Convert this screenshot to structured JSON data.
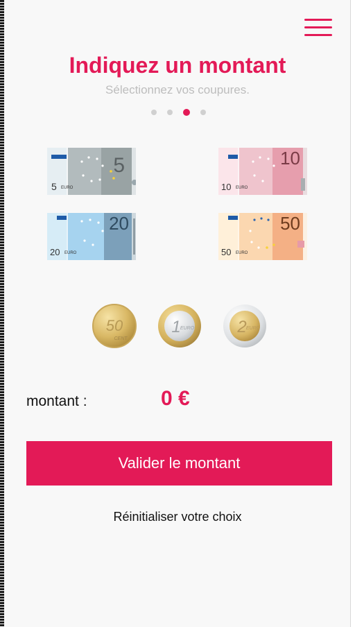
{
  "header": {
    "menu_icon": "hamburger-menu-icon",
    "title": "Indiquez un montant",
    "subtitle": "Sélectionnez vos coupures.",
    "steps_total": 4,
    "active_step": 3
  },
  "notes": [
    {
      "value": "5",
      "euro_label": "EURO",
      "color": "#a6aeb0"
    },
    {
      "value": "10",
      "euro_label": "EURO",
      "color": "#e79aa8"
    },
    {
      "value": "20",
      "euro_label": "EURO",
      "color": "#8ec3e6"
    },
    {
      "value": "50",
      "euro_label": "EURO",
      "color": "#f2a67a"
    }
  ],
  "coins": [
    {
      "value": "50",
      "sub": "CENT"
    },
    {
      "value": "1",
      "sub": "EURO"
    },
    {
      "value": "2",
      "sub": "EURO"
    }
  ],
  "amount": {
    "label": "montant :",
    "value": "0 €"
  },
  "actions": {
    "validate_label": "Valider le montant",
    "reset_label": "Réinitialiser votre choix"
  },
  "colors": {
    "accent": "#e31a57",
    "subtitle": "#bdbdbd",
    "background": "#f8f8f8"
  }
}
